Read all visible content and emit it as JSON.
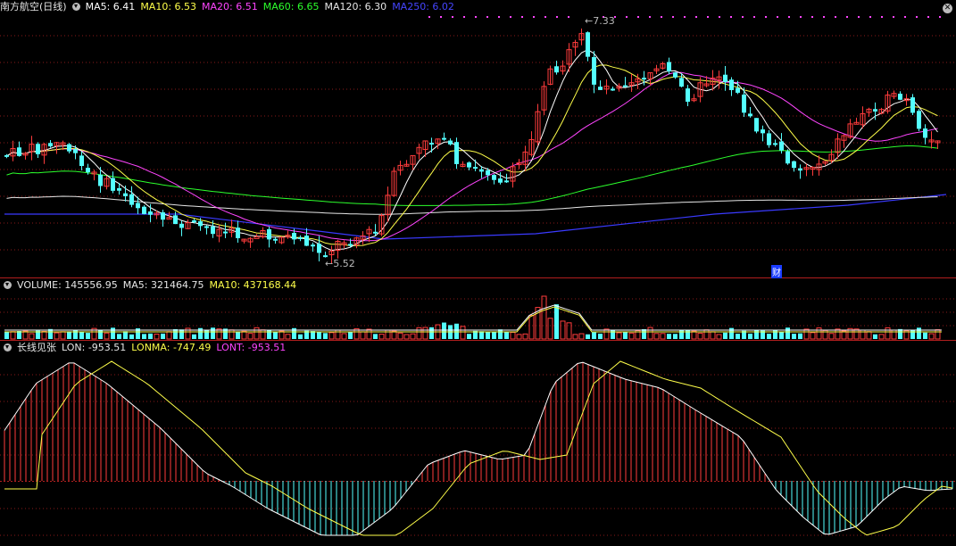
{
  "price_panel": {
    "title": "南方航空(日线)",
    "indicators": [
      {
        "key": "ma5",
        "label": "MA5: 6.41",
        "color": "#ffffff"
      },
      {
        "key": "ma10",
        "label": "MA10: 6.53",
        "color": "#ffff4a"
      },
      {
        "key": "ma20",
        "label": "MA20: 6.51",
        "color": "#ff45ff"
      },
      {
        "key": "ma60",
        "label": "MA60: 6.65",
        "color": "#2cff2c"
      },
      {
        "key": "ma120",
        "label": "MA120: 6.30",
        "color": "#e6e6e6"
      },
      {
        "key": "ma250",
        "label": "MA250: 6.02",
        "color": "#4545ff"
      }
    ],
    "high_label": "7.33",
    "low_label": "5.52",
    "event_marker": "财"
  },
  "volume_panel": {
    "title": "VOLUME: 145556.95",
    "ma5": "MA5: 321464.75",
    "ma10": "MA10: 437168.44"
  },
  "lon_panel": {
    "title": "长线见张",
    "lon": "LON: -953.51",
    "lonma": "LONMA: -747.49",
    "lont": "LONT: -953.51"
  },
  "colors": {
    "up": "#ff3c3c",
    "down": "#54ffff",
    "grid": "#8a1a1a",
    "border": "#b01e1e"
  }
}
